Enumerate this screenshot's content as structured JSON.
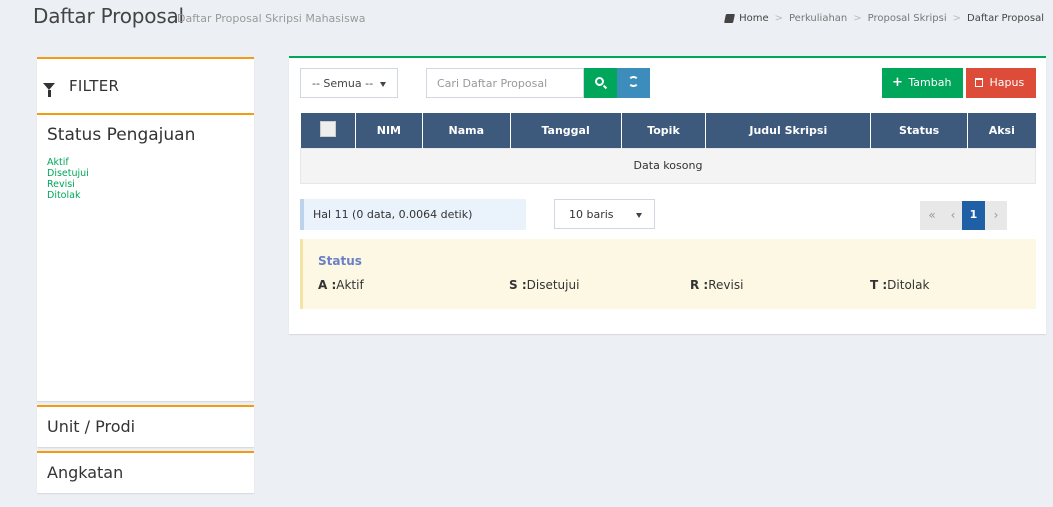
{
  "header": {
    "title": "Daftar Proposal",
    "subtitle": "Daftar Proposal Skripsi Mahasiswa",
    "breadcrumb": [
      "Home",
      "Perkuliahan",
      "Proposal Skripsi",
      "Daftar Proposal"
    ]
  },
  "filter": {
    "title": "FILTER",
    "status_heading": "Status Pengajuan",
    "status_items": [
      "Aktif",
      "Disetujui",
      "Revisi",
      "Ditolak"
    ],
    "sections": [
      "Unit / Prodi",
      "Angkatan"
    ]
  },
  "toolbar": {
    "select_value": "-- Semua --",
    "search_placeholder": "Cari Daftar Proposal",
    "tambah_label": "Tambah",
    "hapus_label": "Hapus"
  },
  "table": {
    "columns": [
      "NIM",
      "Nama",
      "Tanggal",
      "Topik",
      "Judul Skripsi",
      "Status",
      "Aksi"
    ],
    "empty_text": "Data kosong"
  },
  "pagination": {
    "info": "Hal 11 (0 data, 0.0064 detik)",
    "rows_per_page": "10 baris",
    "first": "«",
    "prev": "‹",
    "current_page": "1",
    "next": "›"
  },
  "legend": {
    "title": "Status",
    "items": [
      {
        "code": "A :",
        "label": "Aktif"
      },
      {
        "code": "S :",
        "label": "Disetujui"
      },
      {
        "code": "R :",
        "label": "Revisi"
      },
      {
        "code": "T :",
        "label": "Ditolak"
      }
    ]
  },
  "colors": {
    "accent_orange": "#f39c12",
    "success_green": "#00a65a",
    "danger_red": "#dd4b39",
    "info_blue": "#3c8dbc",
    "table_header": "#3d5a7d"
  }
}
